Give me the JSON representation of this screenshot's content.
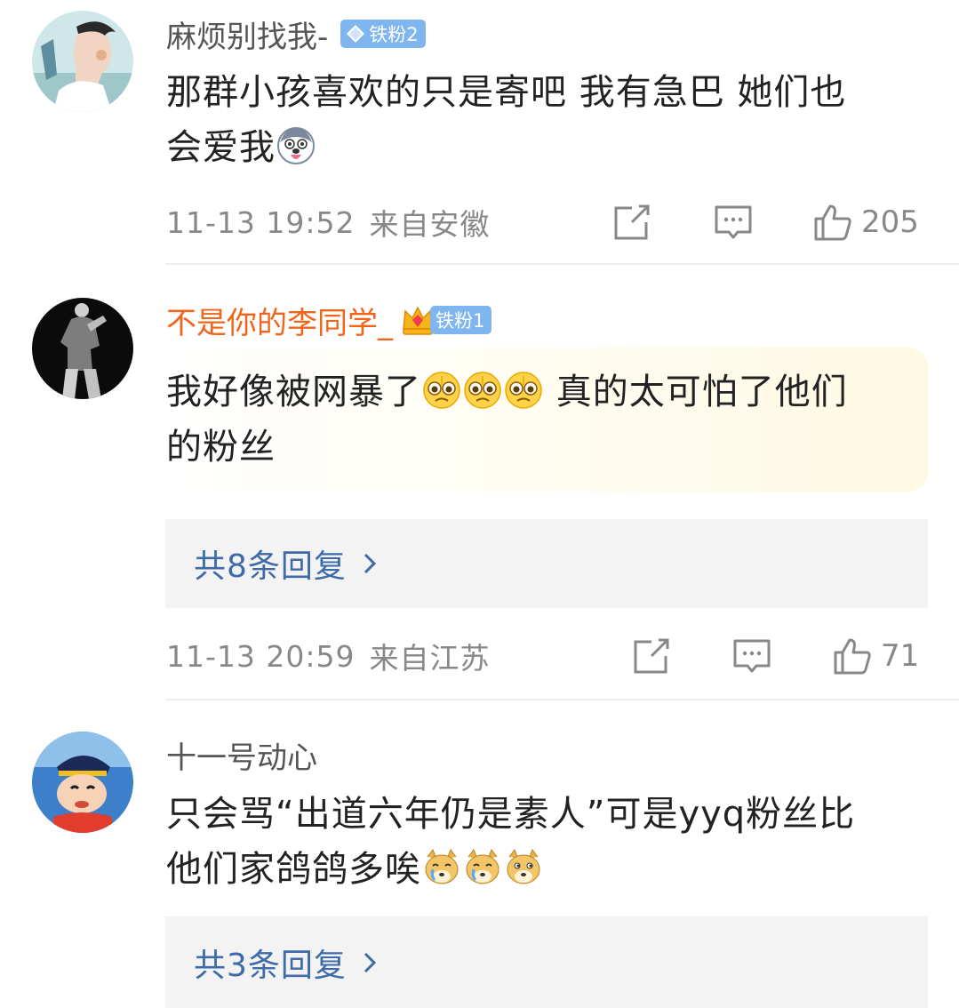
{
  "comments": [
    {
      "username": "麻烦别找我-",
      "badge": "铁粉2",
      "text_line1": "那群小孩喜欢的只是寄吧 我有急巴 她们也",
      "text_line2": "会爱我",
      "emoji_icons": [
        "husky-tongue-emoji"
      ],
      "date": "11-13 19:52",
      "location": "来自安徽",
      "likes": "205"
    },
    {
      "username": "不是你的李同学_",
      "badge": "铁粉1",
      "text_line1_a": "我好像被网暴了",
      "text_line1_b": " 真的太可怕了他们",
      "text_line2": "的粉丝",
      "emoji_icons": [
        "pleading-face-emoji",
        "pleading-face-emoji",
        "pleading-face-emoji"
      ],
      "replies_label": "共8条回复",
      "date": "11-13 20:59",
      "location": "来自江苏",
      "likes": "71"
    },
    {
      "username": "十一号动心",
      "text_line1": "只会骂“出道六年仍是素人”可是yyq粉丝比",
      "text_line2": "他们家鸽鸽多唉",
      "emoji_icons": [
        "doge-crying-emoji",
        "doge-crying-emoji",
        "doge-emoji"
      ],
      "replies_label": "共3条回复"
    }
  ],
  "colors": {
    "vip_name": "#f0651c",
    "link": "#3d6aa8",
    "meta": "#888888",
    "badge": "#7fb6f0"
  }
}
